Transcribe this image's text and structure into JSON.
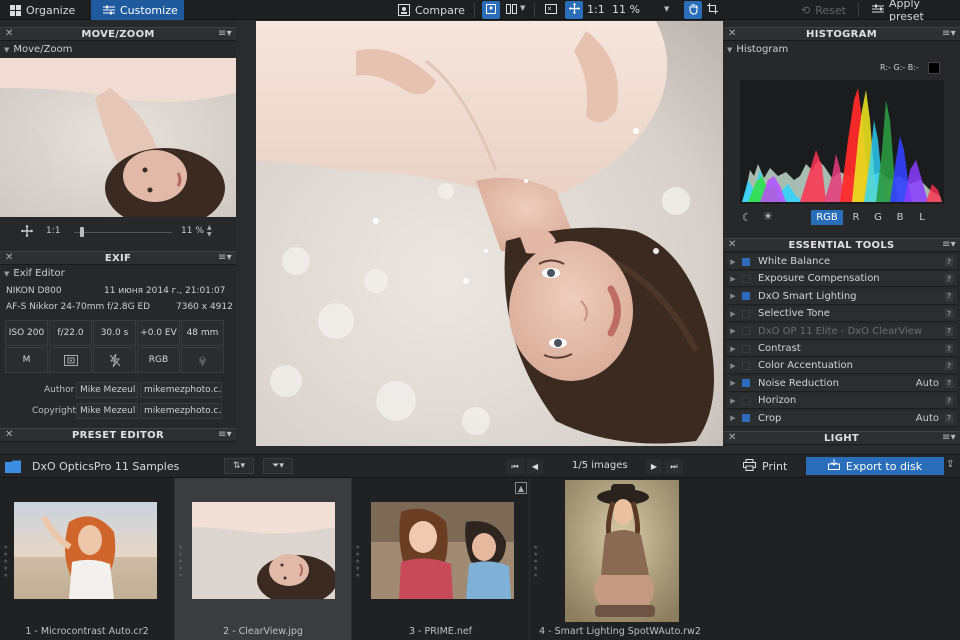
{
  "topbar": {
    "organize_label": "Organize",
    "customize_label": "Customize",
    "compare_label": "Compare",
    "ratio_label": "1:1",
    "zoom_value": "11 %",
    "reset_label": "Reset",
    "apply_preset_label": "Apply preset"
  },
  "move_zoom": {
    "panel_title": "MOVE/ZOOM",
    "subtitle": "Move/Zoom",
    "ratio": "1:1",
    "zoom_value": "11 %"
  },
  "exif": {
    "panel_title": "EXIF",
    "subtitle": "Exif Editor",
    "camera": "NIKON D800",
    "date": "11 июня 2014 г., 21:01:07",
    "lens": "AF-S Nikkor 24-70mm f/2.8G ED",
    "dimensions": "7360 x 4912",
    "grid_row1": [
      "ISO 200",
      "f/22.0",
      "30.0 s",
      "+0.0 EV",
      "48 mm"
    ],
    "grid_row2": [
      "M",
      "",
      "",
      "RGB",
      ""
    ],
    "author_label": "Author",
    "author_value": "Mike Mezeul II",
    "author_url": "mikemezphoto.c…",
    "copyright_label": "Copyright",
    "copyright_value": "Mike Mezeul II",
    "copyright_url": "mikemezphoto.c…"
  },
  "preset_editor": {
    "panel_title": "PRESET EDITOR"
  },
  "histogram": {
    "panel_title": "HISTOGRAM",
    "subtitle": "Histogram",
    "readout": "R:- G:- B:-",
    "channels": [
      "RGB",
      "R",
      "G",
      "B",
      "L"
    ],
    "active_channel": "RGB"
  },
  "essential_tools": {
    "panel_title": "ESSENTIAL TOOLS",
    "items": [
      {
        "label": "White Balance",
        "value": "",
        "enabled": true,
        "dim": false
      },
      {
        "label": "Exposure Compensation",
        "value": "",
        "enabled": false,
        "dim": false
      },
      {
        "label": "DxO Smart Lighting",
        "value": "",
        "enabled": true,
        "dim": false
      },
      {
        "label": "Selective Tone",
        "value": "",
        "enabled": false,
        "dim": false
      },
      {
        "label": "DxO OP 11 Elite - DxO ClearView",
        "value": "",
        "enabled": false,
        "dim": true
      },
      {
        "label": "Contrast",
        "value": "",
        "enabled": false,
        "dim": false
      },
      {
        "label": "Color Accentuation",
        "value": "",
        "enabled": false,
        "dim": false
      },
      {
        "label": "Noise Reduction",
        "value": "Auto",
        "enabled": true,
        "dim": false
      },
      {
        "label": "Horizon",
        "value": "",
        "enabled": false,
        "dim": false
      },
      {
        "label": "Crop",
        "value": "Auto",
        "enabled": true,
        "dim": false
      }
    ]
  },
  "light": {
    "panel_title": "LIGHT"
  },
  "browser": {
    "folder_name": "DxO OpticsPro 11 Samples",
    "image_count": "1/5 images",
    "print_label": "Print",
    "export_label": "Export to disk"
  },
  "filmstrip": [
    {
      "label": "1 - Microcontrast Auto.cr2",
      "selected": false
    },
    {
      "label": "2 - ClearView.jpg",
      "selected": true
    },
    {
      "label": "3 - PRIME.nef",
      "selected": false
    },
    {
      "label": "4 - Smart Lighting SpotWAuto.rw2",
      "selected": false
    }
  ],
  "colors": {
    "accent": "#2a6db8",
    "panel_bg": "#27282a",
    "topbar_bg": "#1e1f21"
  }
}
